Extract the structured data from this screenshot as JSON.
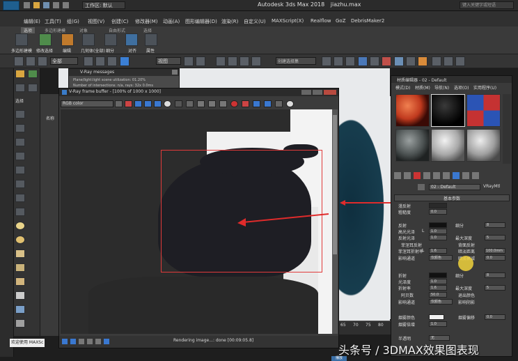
{
  "window_title": "Autodesk 3ds Max 2018",
  "window_title_file": "jiazhu.max",
  "workspace_label": "工作区: 默认",
  "search_placeholder": "键入关键字或短语",
  "menus": [
    "编辑(E)",
    "工具(T)",
    "组(G)",
    "视图(V)",
    "创建(C)",
    "修改器(M)",
    "动画(A)",
    "图形编辑器(D)",
    "渲染(R)",
    "自定义(U)",
    "MAXScript(X)",
    "Realflow",
    "GoZ",
    "DebrisMaker2"
  ],
  "ribbon_tabs": [
    "选项",
    "多边形建模",
    "对象",
    "自由形式",
    "选择"
  ],
  "ribbon_tools": [
    "多边形建模",
    "修改选择",
    "编辑",
    "几何体(全部)",
    "细分",
    "三角剖分",
    "对齐",
    "属性"
  ],
  "viewport_dropdown": "视图",
  "selection_set": "全部",
  "create_selection_set": "创建选择集",
  "vray_messages": {
    "title": "V-Ray messages",
    "lines": [
      "Plane/light:light scene utilization: 01.20%",
      "Number of intersections: n/a, rays: 32x 0.0ms"
    ]
  },
  "frame_buffer": {
    "title": "V-Ray frame buffer - [100% of 1000 x 1000]",
    "channel": "RGB color",
    "status": "Rendering image...: done [00:09:05.8]"
  },
  "material_editor": {
    "title": "材质编辑器 - 02 - Default",
    "menus": [
      "模式(D)",
      "材质(M)",
      "导航(N)",
      "选项(O)",
      "实用程序(U)"
    ],
    "material_name": "02 - Default",
    "material_type": "VRayMtl",
    "rollout": "基本参数",
    "params": {
      "bump": "漫反射",
      "roughness": "粗糙度",
      "roughness_val": "0.0",
      "reflect": "反射",
      "hilight_gloss": "高光光泽",
      "hilight_val": "L",
      "hilight_num": "1.0",
      "refl_gloss": "反射光泽",
      "refl_gloss_val": "1.0",
      "fresnel": "菲涅耳反射",
      "fresnel_ior": "菲涅耳折射率",
      "fresnel_val": "L",
      "fresnel_num": "1.6",
      "subdivs": "细分",
      "subdivs_val": "8",
      "max_depth": "最大深度",
      "max_depth_val": "5",
      "use_interp": "使用插值",
      "dim_dist": "暗淡距离",
      "dim_dist_val": "100.0mm",
      "dim_falloff": "暗淡衰减",
      "dim_falloff_val": "0.0",
      "back_refl": "背面反射",
      "exit_color": "退出颜色",
      "affect_channels": "影响通道",
      "affect_channels_val": "仅颜色",
      "refract": "折射",
      "refr_gloss": "光泽度",
      "refr_gloss_val": "1.0",
      "ior": "折射率",
      "ior_val": "1.6",
      "abbe": "阿贝数",
      "abbe_val": "50.0",
      "refr_subdivs": "细分",
      "refr_subdivs_val": "8",
      "refr_max_depth": "最大深度",
      "refr_max_depth_val": "5",
      "refr_exit": "退出颜色",
      "affect_shadows": "影响阴影",
      "fog_color": "烟雾颜色",
      "fog_mult": "烟雾倍增",
      "fog_mult_val": "1.0",
      "fog_bias": "烟雾偏移",
      "fog_bias_val": "0.0",
      "translucency": "半透明",
      "translucency_val": "无"
    }
  },
  "left_panel_label": "选择",
  "left_column_label": "名称",
  "timeline": {
    "frames": [
      "65",
      "70",
      "75",
      "80"
    ],
    "welcome": "欢迎使用 MAXSc"
  },
  "watermark": "头条号 / 3DMAX效果图表现",
  "bottom_tag": "播放"
}
